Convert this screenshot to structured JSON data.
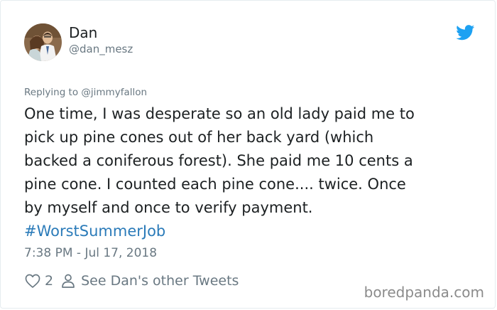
{
  "tweet": {
    "author_name": "Dan",
    "author_handle": "@dan_mesz",
    "replying_prefix": "Replying to ",
    "replying_to": "@jimmyfallon",
    "body_lines": [
      "One time, I was desperate so an old lady paid me to",
      "pick up pine cones out of her back yard (which",
      "backed a coniferous forest). She paid me 10 cents a",
      "pine cone. I counted each pine cone.... twice. Once",
      "by myself and once to verify payment."
    ],
    "hashtag": "#WorstSummerJob",
    "timestamp": "7:38 PM - Jul 17, 2018",
    "like_count": "2",
    "other_tweets_label": "See Dan's other Tweets"
  },
  "watermark": "boredpanda.com",
  "colors": {
    "link": "#2b7bb9",
    "twitter_blue": "#1da1f2",
    "muted": "#697882",
    "text": "#1c2022"
  },
  "icons": {
    "brand": "twitter-bird-icon",
    "like": "heart-icon",
    "profile": "person-icon"
  }
}
